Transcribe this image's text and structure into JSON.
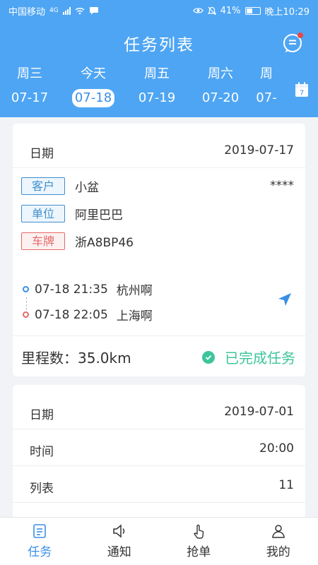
{
  "status_bar": {
    "carrier": "中国移动",
    "network": "4G",
    "battery": "41%",
    "time": "晚上10:29"
  },
  "header": {
    "title": "任务列表",
    "message_icon": "chat-icon",
    "calendar_icon": "calendar-icon",
    "calendar_day": "7"
  },
  "days": [
    {
      "week": "周三",
      "date": "07-17"
    },
    {
      "week": "今天",
      "date": "07-18",
      "active": true
    },
    {
      "week": "周五",
      "date": "07-19"
    },
    {
      "week": "周六",
      "date": "07-20"
    },
    {
      "week": "周",
      "date": "07-"
    }
  ],
  "task1": {
    "date_label": "日期",
    "date_value": "2019-07-17",
    "customer_tag": "客户",
    "customer": "小盆",
    "masked": "****",
    "unit_tag": "单位",
    "unit": "阿里巴巴",
    "plate_tag": "车牌",
    "plate": "浙A8BP46",
    "start_time": "07-18 21:35",
    "start_place": "杭州啊",
    "end_time": "07-18 22:05",
    "end_place": "上海啊",
    "mileage": "里程数：35.0km",
    "status": "已完成任务"
  },
  "task2": {
    "date_label": "日期",
    "date_value": "2019-07-01",
    "time_label": "时间",
    "time_value": "20:00",
    "list_label": "列表",
    "list_value": "11"
  },
  "nav": [
    {
      "label": "任务",
      "icon": "task-list-icon",
      "active": true
    },
    {
      "label": "通知",
      "icon": "speaker-icon"
    },
    {
      "label": "抢单",
      "icon": "hand-tap-icon"
    },
    {
      "label": "我的",
      "icon": "user-icon"
    }
  ],
  "colors": {
    "primary": "#4ea5f3",
    "success": "#3cc59a",
    "tag_blue": "#3f8ecd",
    "tag_red": "#e46a6a"
  }
}
